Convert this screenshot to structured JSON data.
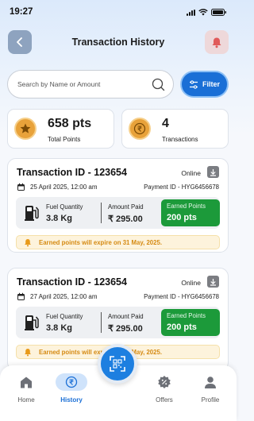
{
  "status_bar": {
    "time": "19:27"
  },
  "header": {
    "title": "Transaction History"
  },
  "search": {
    "placeholder": "Search by Name or Amount"
  },
  "filter": {
    "label": "Filter"
  },
  "stats": {
    "points": {
      "value": "658 pts",
      "label": "Total Points",
      "icon": "star-icon"
    },
    "transactions": {
      "value": "4",
      "label": "Transactions",
      "icon": "rupee-icon"
    }
  },
  "transactions": [
    {
      "title": "Transaction ID - 123654",
      "mode": "Online",
      "date": "25 April 2025, 12:00 am",
      "payment_id": "Payment ID - HYG6456678",
      "fuel_label": "Fuel Quantity",
      "fuel_value": "3.8 Kg",
      "amount_label": "Amount Paid",
      "amount_value": "₹ 295.00",
      "earned_label": "Earned Points",
      "earned_value": "200 pts",
      "expiry": "Earned points will expire on  31 May, 2025."
    },
    {
      "title": "Transaction ID - 123654",
      "mode": "Online",
      "date": "27 April 2025, 12:00 am",
      "payment_id": "Payment ID - HYG6456678",
      "fuel_label": "Fuel Quantity",
      "fuel_value": "3.8 Kg",
      "amount_label": "Amount Paid",
      "amount_value": "₹ 295.00",
      "earned_label": "Earned Points",
      "earned_value": "200 pts",
      "expiry": "Earned points will expire on  31 May, 2025."
    }
  ],
  "nav": {
    "items": [
      {
        "label": "Home",
        "icon": "home-icon"
      },
      {
        "label": "History",
        "icon": "rupee-history-icon",
        "active": true
      },
      {
        "label": "Offers",
        "icon": "offers-icon"
      },
      {
        "label": "Profile",
        "icon": "profile-icon"
      }
    ],
    "center_icon": "qr-scan-icon"
  },
  "colors": {
    "primary": "#1a6fd6",
    "earned_green": "#1c9a3a",
    "expiry_text": "#d58a12",
    "coin": "#e8a23a"
  }
}
